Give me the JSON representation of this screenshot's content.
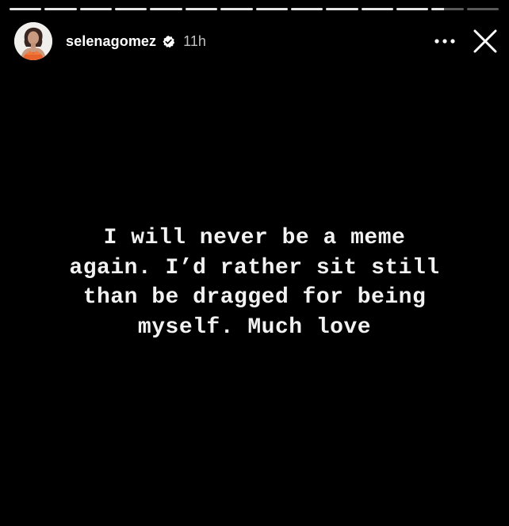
{
  "story": {
    "progress": [
      1,
      1,
      1,
      1,
      1,
      1,
      1,
      1,
      1,
      1,
      1,
      1,
      0.4,
      0
    ],
    "user": {
      "username": "selenagomez",
      "time": "11h",
      "verified": true,
      "avatar": "profile-photo"
    },
    "caption": "I will never be a meme\nagain. I’d rather sit still\nthan be dragged for being\nmyself. Much love",
    "icons": {
      "more": "more-horizontal-icon",
      "close": "close-icon",
      "verified": "verified-badge-icon"
    },
    "colors": {
      "background": "#000000",
      "text": "#ffffff",
      "progress_fill": "#e6e6e6",
      "progress_track": "rgba(255,255,255,0.35)"
    }
  }
}
